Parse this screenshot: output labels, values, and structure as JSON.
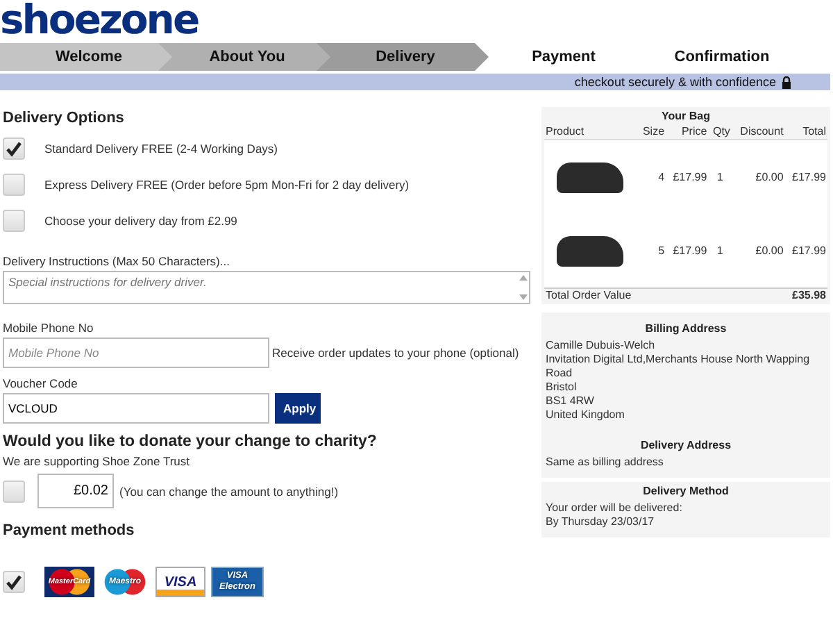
{
  "logo": "shoezone",
  "steps": [
    {
      "label": "Welcome",
      "completed": true,
      "selected": false
    },
    {
      "label": "About You",
      "completed": true,
      "selected": false
    },
    {
      "label": "Delivery",
      "completed": false,
      "selected": true
    },
    {
      "label": "Payment",
      "completed": false,
      "selected": false
    },
    {
      "label": "Confirmation",
      "completed": false,
      "selected": false
    }
  ],
  "secure_note": "checkout securely & with confidence",
  "delivery": {
    "title": "Delivery Options",
    "options": [
      {
        "label": "Standard Delivery FREE (2-4 Working Days)",
        "checked": true
      },
      {
        "label": "Express Delivery FREE (Order before 5pm Mon-Fri for 2 day delivery)",
        "checked": false
      },
      {
        "label": "Choose your delivery day from £2.99",
        "checked": false
      }
    ],
    "instructions_label": "Delivery Instructions (Max 50 Characters)...",
    "instructions_placeholder": "Special instructions for delivery driver.",
    "phone_label": "Mobile Phone No",
    "phone_placeholder": "Mobile Phone No",
    "phone_note": "Receive order updates to your phone (optional)",
    "voucher_label": "Voucher Code",
    "voucher_value": "VCLOUD",
    "apply_button": "Apply"
  },
  "charity": {
    "title": "Would you like to donate your change to charity?",
    "subtitle": "We are supporting Shoe Zone Trust",
    "checked": false,
    "amount": "£0.02",
    "note": "(You can change the amount to anything!)"
  },
  "payment": {
    "title": "Payment methods",
    "checked": true,
    "cards": [
      {
        "kind": "mastercard",
        "label": "MasterCard"
      },
      {
        "kind": "maestro",
        "label": "Maestro"
      },
      {
        "kind": "visa",
        "label": "VISA"
      },
      {
        "kind": "electron",
        "label": "VISA Electron"
      }
    ]
  },
  "bag": {
    "title": "Your Bag",
    "columns": [
      "Product",
      "Size",
      "Price",
      "Qty",
      "Discount",
      "Total"
    ],
    "rows": [
      {
        "size": "4",
        "price": "£17.99",
        "qty": "1",
        "discount": "£0.00",
        "total": "£17.99"
      },
      {
        "size": "5",
        "price": "£17.99",
        "qty": "1",
        "discount": "£0.00",
        "total": "£17.99"
      }
    ],
    "total_label": "Total Order Value",
    "total_value": "£35.98"
  },
  "billing": {
    "title": "Billing Address",
    "lines": [
      "Camille Dubuis-Welch",
      "Invitation Digital Ltd,Merchants House North Wapping Road",
      "Bristol",
      "BS1 4RW",
      "United Kingdom"
    ]
  },
  "delivery_address": {
    "title": "Delivery Address",
    "text": "Same as billing address"
  },
  "delivery_method": {
    "title": "Delivery Method",
    "lines": [
      "Your order will be delivered:",
      "By Thursday 23/03/17"
    ]
  }
}
